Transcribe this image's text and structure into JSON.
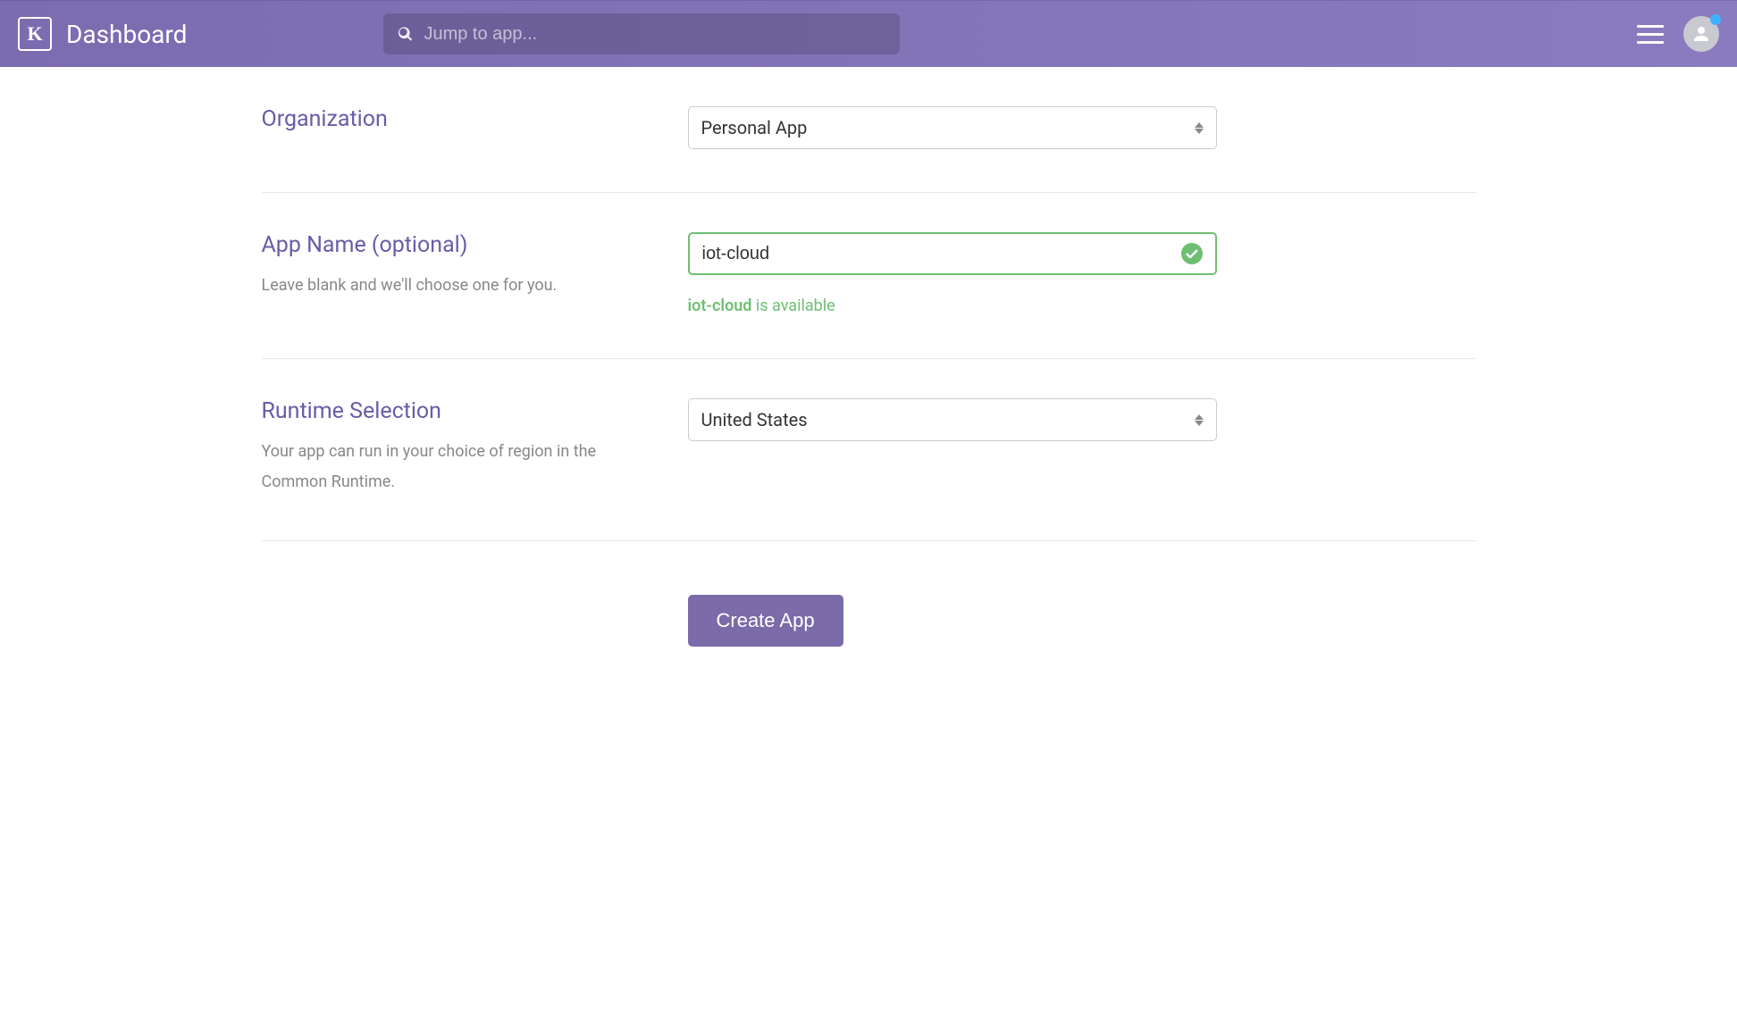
{
  "header": {
    "title": "Dashboard",
    "search_placeholder": "Jump to app..."
  },
  "form": {
    "organization": {
      "label": "Organization",
      "selected": "Personal App"
    },
    "app_name": {
      "label": "App Name (optional)",
      "help": "Leave blank and we'll choose one for you.",
      "value": "iot-cloud",
      "availability_name": "iot-cloud",
      "availability_suffix": " is available"
    },
    "runtime": {
      "label": "Runtime Selection",
      "help": "Your app can run in your choice of region in the Common Runtime.",
      "selected": "United States"
    },
    "submit_label": "Create App"
  }
}
